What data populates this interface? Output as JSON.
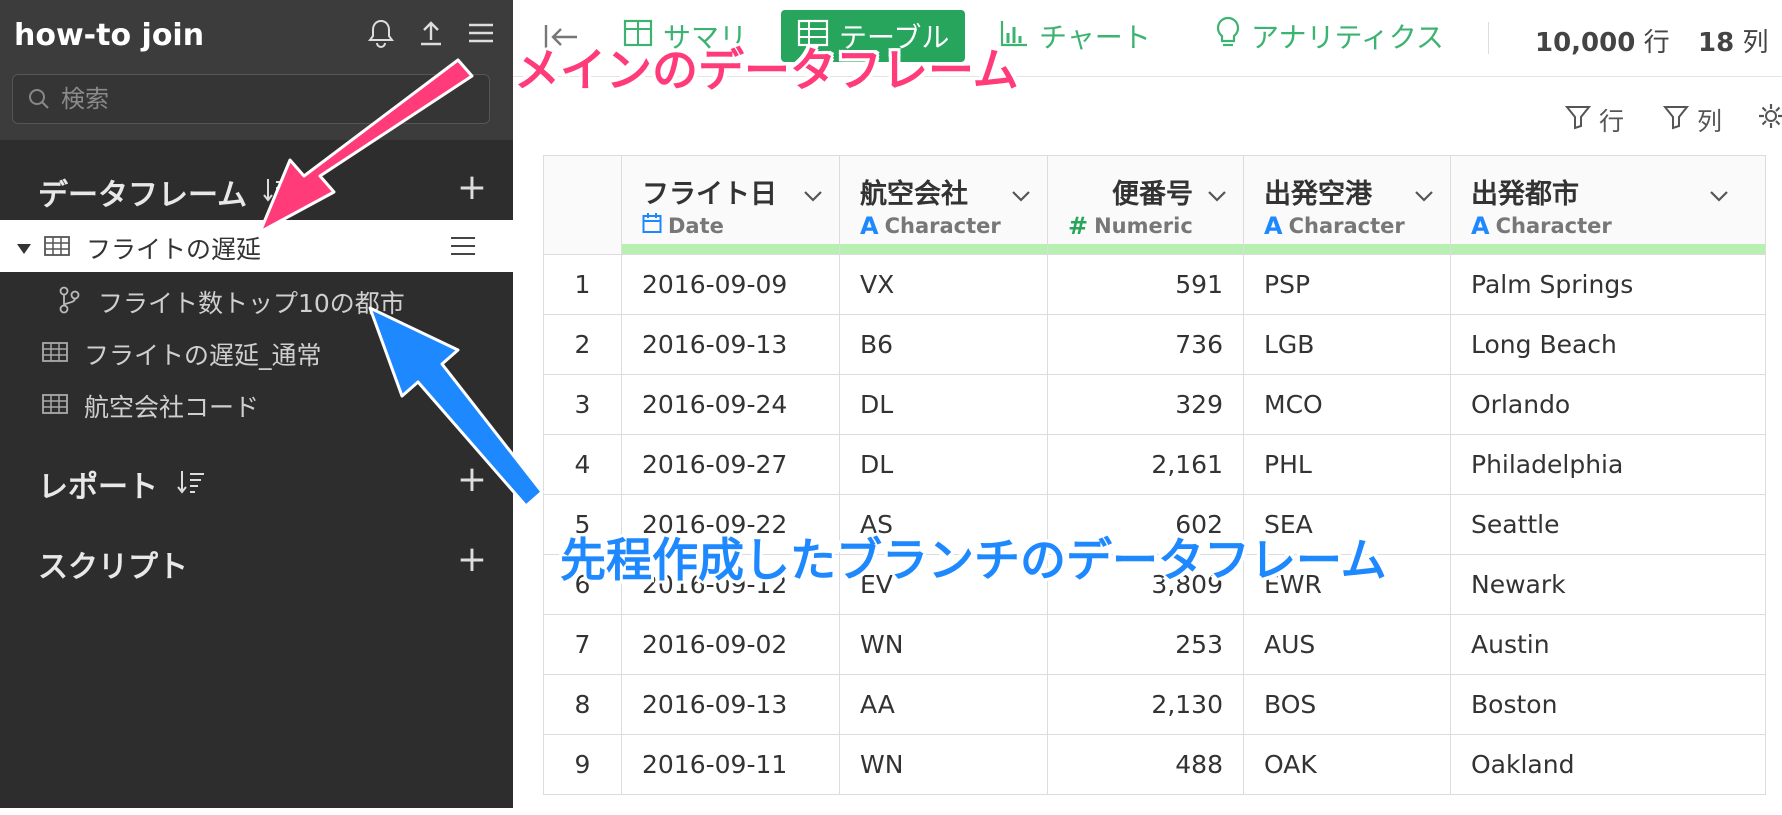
{
  "sidebar": {
    "title": "how-to join",
    "search_placeholder": "検索",
    "sections": {
      "dataframes": "データフレーム",
      "reports": "レポート",
      "scripts": "スクリプト"
    },
    "items": {
      "item1": "フライトの遅延",
      "item1_child": "フライト数トップ10の都市",
      "item2": "フライトの遅延_通常",
      "item3": "航空会社コード"
    }
  },
  "tabs": {
    "summary": "サマリ",
    "table": "テーブル",
    "chart": "チャート",
    "analytics": "アナリティクス"
  },
  "counts": {
    "rows_value": "10,000",
    "rows_unit": "行",
    "cols_value": "18",
    "cols_unit": "列"
  },
  "filters": {
    "row": "行",
    "col": "列"
  },
  "table": {
    "columns": [
      {
        "name": "フライト日",
        "type": "Date"
      },
      {
        "name": "航空会社",
        "type": "Character"
      },
      {
        "name": "便番号",
        "type": "Numeric"
      },
      {
        "name": "出発空港",
        "type": "Character"
      },
      {
        "name": "出発都市",
        "type": "Character"
      }
    ],
    "rows": [
      [
        "1",
        "2016-09-09",
        "VX",
        "591",
        "PSP",
        "Palm Springs"
      ],
      [
        "2",
        "2016-09-13",
        "B6",
        "736",
        "LGB",
        "Long Beach"
      ],
      [
        "3",
        "2016-09-24",
        "DL",
        "329",
        "MCO",
        "Orlando"
      ],
      [
        "4",
        "2016-09-27",
        "DL",
        "2,161",
        "PHL",
        "Philadelphia"
      ],
      [
        "5",
        "2016-09-22",
        "AS",
        "602",
        "SEA",
        "Seattle"
      ],
      [
        "6",
        "2016-09-12",
        "EV",
        "3,809",
        "EWR",
        "Newark"
      ],
      [
        "7",
        "2016-09-02",
        "WN",
        "253",
        "AUS",
        "Austin"
      ],
      [
        "8",
        "2016-09-13",
        "AA",
        "2,130",
        "BOS",
        "Boston"
      ],
      [
        "9",
        "2016-09-11",
        "WN",
        "488",
        "OAK",
        "Oakland"
      ]
    ]
  },
  "annotations": {
    "main_df": "メインのデータフレーム",
    "branch_df": "先程作成したブランチのデータフレーム"
  },
  "colors": {
    "accent_green": "#27a55c",
    "annotation_pink": "#ff3b7a",
    "annotation_blue": "#1e88ff",
    "sidebar_bg": "#2d2d2d"
  }
}
